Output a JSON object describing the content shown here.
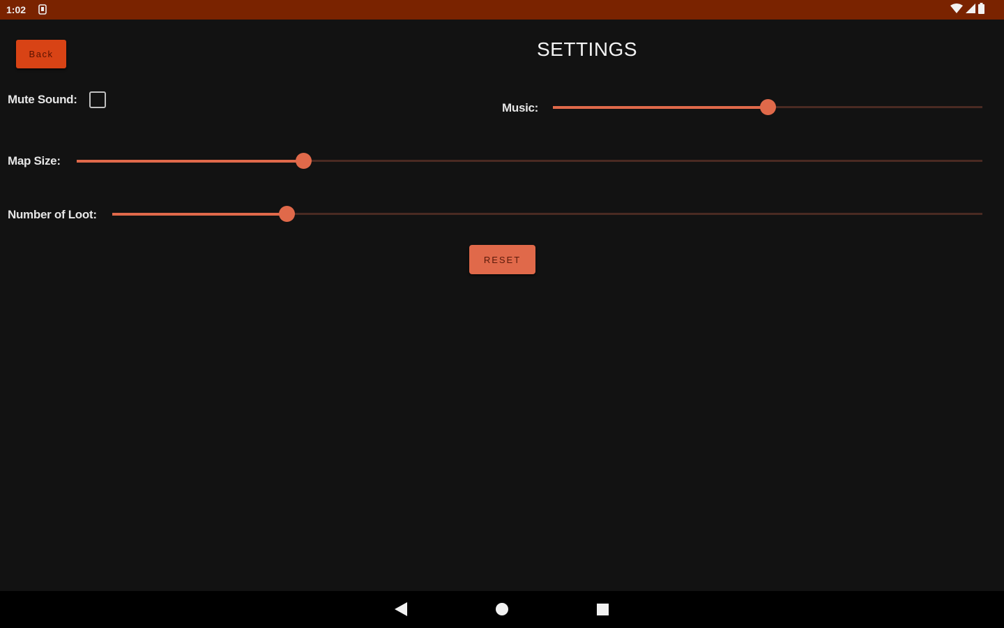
{
  "status_bar": {
    "time": "1:02",
    "icons": [
      "notification-icon",
      "wifi-icon",
      "signal-icon",
      "battery-icon"
    ]
  },
  "header": {
    "back_label": "Back",
    "title": "SETTINGS"
  },
  "settings": {
    "mute_label": "Mute Sound:",
    "mute_checked": false,
    "music_label": "Music:",
    "music_value": 0.5,
    "map_size_label": "Map Size:",
    "map_size_value": 0.25,
    "loot_label": "Number of Loot:",
    "loot_value": 0.2
  },
  "reset_label": "RESET",
  "navbar": {
    "icons": [
      "back-nav-icon",
      "home-nav-icon",
      "recents-nav-icon"
    ]
  },
  "colors": {
    "accent": "#e0694a",
    "back_button": "#d84315",
    "status_bar": "#7a2300",
    "background": "#121212"
  }
}
